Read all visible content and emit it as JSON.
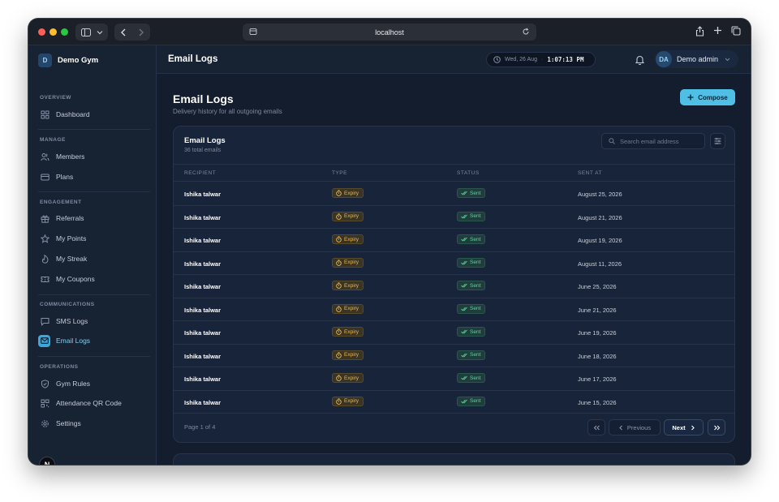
{
  "browser": {
    "url": "localhost"
  },
  "app": {
    "brand_initial": "D",
    "brand_name": "Demo Gym",
    "n_badge": "N"
  },
  "sidebar": {
    "sections": [
      {
        "heading": "OVERVIEW",
        "items": [
          {
            "label": "Dashboard",
            "icon": "grid-icon"
          }
        ]
      },
      {
        "heading": "MANAGE",
        "items": [
          {
            "label": "Members",
            "icon": "users-icon"
          },
          {
            "label": "Plans",
            "icon": "card-icon"
          }
        ]
      },
      {
        "heading": "ENGAGEMENT",
        "items": [
          {
            "label": "Referrals",
            "icon": "gift-icon"
          },
          {
            "label": "My Points",
            "icon": "star-icon"
          },
          {
            "label": "My Streak",
            "icon": "flame-icon"
          },
          {
            "label": "My Coupons",
            "icon": "ticket-icon"
          }
        ]
      },
      {
        "heading": "COMMUNICATIONS",
        "items": [
          {
            "label": "SMS Logs",
            "icon": "message-icon"
          },
          {
            "label": "Email Logs",
            "icon": "mail-icon",
            "active": true
          }
        ]
      },
      {
        "heading": "OPERATIONS",
        "items": [
          {
            "label": "Gym Rules",
            "icon": "shield-icon"
          },
          {
            "label": "Attendance QR Code",
            "icon": "qr-icon"
          },
          {
            "label": "Settings",
            "icon": "gear-icon"
          }
        ]
      }
    ]
  },
  "topbar": {
    "title": "Email Logs",
    "date": "Wed, 26 Aug",
    "time": "1:07:13 PM",
    "user_initials": "DA",
    "user_name": "Demo admin"
  },
  "page": {
    "title": "Email Logs",
    "subtitle": "Delivery history for all outgoing emails",
    "compose_label": "Compose"
  },
  "card": {
    "title": "Email Logs",
    "subtitle": "36 total emails",
    "search_placeholder": "Search email address",
    "columns": [
      "RECIPIENT",
      "TYPE",
      "STATUS",
      "SENT AT"
    ],
    "rows": [
      {
        "recipient": "Ishika talwar",
        "type": "Expiry",
        "status": "Sent",
        "sent_at": "August 25, 2026"
      },
      {
        "recipient": "Ishika talwar",
        "type": "Expiry",
        "status": "Sent",
        "sent_at": "August 21, 2026"
      },
      {
        "recipient": "Ishika talwar",
        "type": "Expiry",
        "status": "Sent",
        "sent_at": "August 19, 2026"
      },
      {
        "recipient": "Ishika talwar",
        "type": "Expiry",
        "status": "Sent",
        "sent_at": "August 11, 2026"
      },
      {
        "recipient": "Ishika talwar",
        "type": "Expiry",
        "status": "Sent",
        "sent_at": "June 25, 2026"
      },
      {
        "recipient": "Ishika talwar",
        "type": "Expiry",
        "status": "Sent",
        "sent_at": "June 21, 2026"
      },
      {
        "recipient": "Ishika talwar",
        "type": "Expiry",
        "status": "Sent",
        "sent_at": "June 19, 2026"
      },
      {
        "recipient": "Ishika talwar",
        "type": "Expiry",
        "status": "Sent",
        "sent_at": "June 18, 2026"
      },
      {
        "recipient": "Ishika talwar",
        "type": "Expiry",
        "status": "Sent",
        "sent_at": "June 17, 2026"
      },
      {
        "recipient": "Ishika talwar",
        "type": "Expiry",
        "status": "Sent",
        "sent_at": "June 15, 2026"
      }
    ],
    "pagination": {
      "text": "Page 1 of 4",
      "previous": "Previous",
      "next": "Next"
    }
  },
  "colors": {
    "accent": "#4fbfe6",
    "expiry": "#e9b652",
    "sent": "#5fd3a8",
    "background": "#141d2e"
  }
}
